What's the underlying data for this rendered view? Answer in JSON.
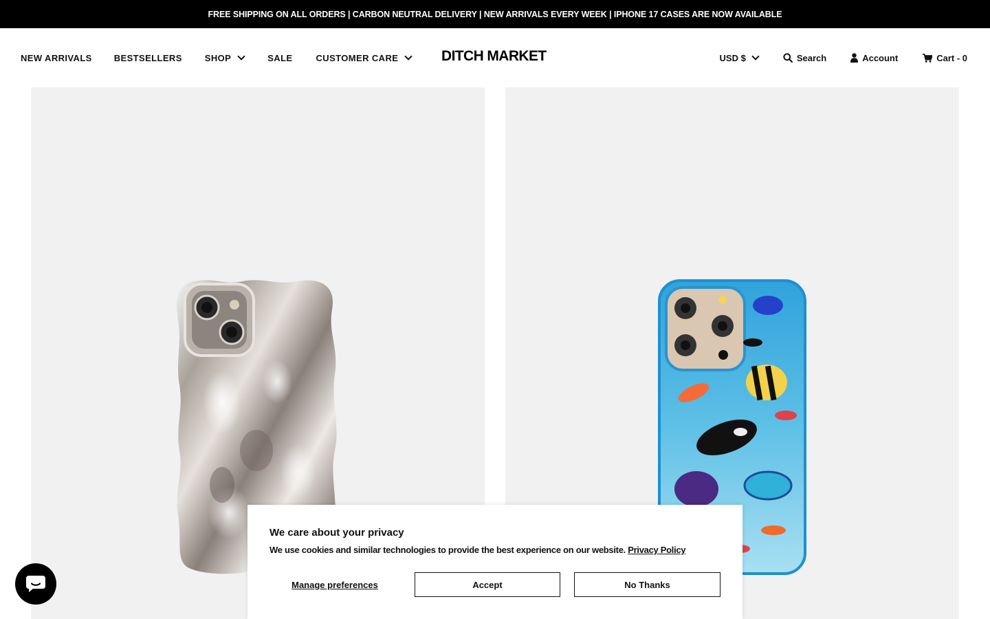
{
  "announcement": {
    "text": "FREE SHIPPING ON ALL ORDERS | CARBON NEUTRAL DELIVERY | NEW ARRIVALS EVERY WEEK | IPHONE 17 CASES ARE NOW AVAILABLE"
  },
  "nav": {
    "new_arrivals": "NEW ARRIVALS",
    "bestsellers": "BESTSELLERS",
    "shop": "SHOP",
    "sale": "SALE",
    "customer_care": "CUSTOMER CARE"
  },
  "logo": "DITCH MARKET",
  "utility": {
    "currency": "USD $",
    "search": "Search",
    "account": "Account",
    "cart": "Cart - 0"
  },
  "products": [
    {
      "icon": "silver-wavy-phone-case-image"
    },
    {
      "icon": "aquarium-fish-phone-case-image"
    }
  ],
  "cookie_banner": {
    "title": "We care about your privacy",
    "text": "We use cookies and similar technologies to provide the best experience on our website.",
    "policy_link": "Privacy Policy",
    "manage": "Manage preferences",
    "accept": "Accept",
    "decline": "No Thanks"
  },
  "chat": {
    "icon": "chat-bubble-icon"
  },
  "colors": {
    "announcement_bg": "#000000",
    "card_bg": "#f1f1f1",
    "chat_bg": "#000000"
  }
}
